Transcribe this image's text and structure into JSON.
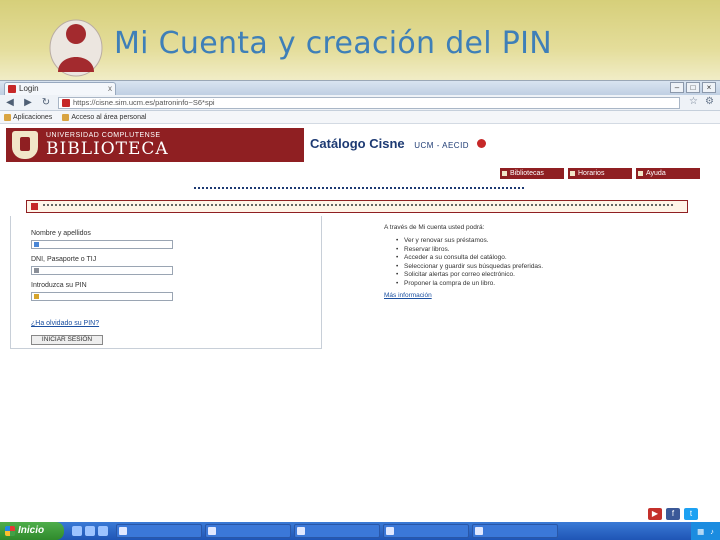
{
  "slide": {
    "title": "Mi Cuenta y creación del PIN"
  },
  "browser": {
    "tab_title": "Login",
    "tab_close": "x",
    "url": "https://cisne.sim.ucm.es/patroninfo~S6*spi",
    "bookmarks": [
      "Aplicaciones",
      "Acceso al área personal"
    ]
  },
  "page": {
    "banner_univ": "UNIVERSIDAD COMPLUTENSE",
    "banner_bib": "BIBLIOTECA",
    "catalog_title": "Catálogo Cisne",
    "catalog_sub": "UCM - AECID",
    "top_links": [
      "Bibliotecas",
      "Horarios",
      "Ayuda"
    ],
    "login": {
      "name_label": "Nombre y apellidos",
      "dni_label": "DNI, Pasaporte o TIJ",
      "pin_label": "Introduzca su PIN",
      "forgot_label": "¿Ha olvidado su PIN?",
      "button_label": "INICIAR SESIÓN"
    },
    "info": {
      "intro": "A través de Mi cuenta usted podrá:",
      "items": [
        "Ver y renovar sus préstamos.",
        "Reservar libros.",
        "Acceder a su consulta del catálogo.",
        "Seleccionar y guardir sus búsquedas preferidas.",
        "Solicitar alertas por correo electrónico.",
        "Proponer la compra de un libro."
      ],
      "more_link": "Más información"
    }
  },
  "taskbar": {
    "start_label": "Inicio"
  }
}
